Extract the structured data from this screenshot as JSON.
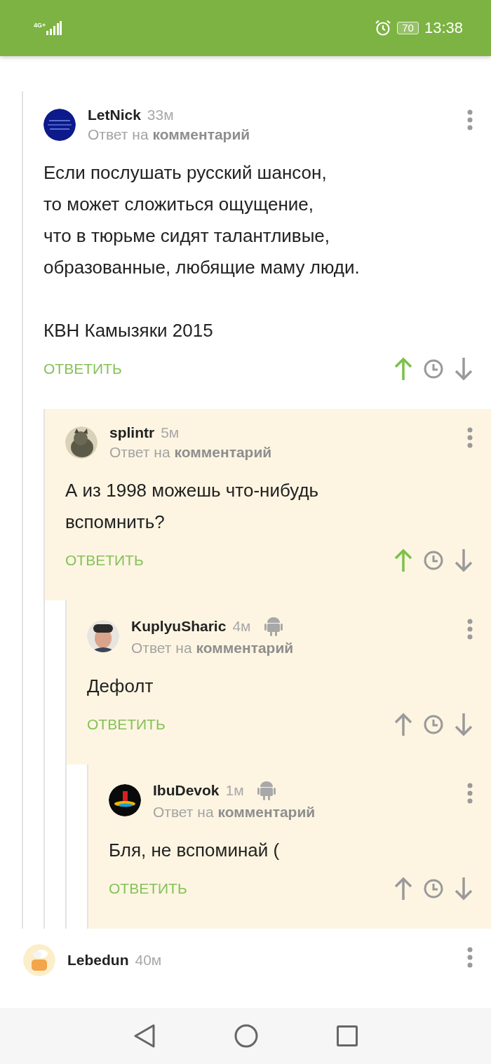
{
  "status_bar": {
    "network": "4G+",
    "battery": "70",
    "time": "13:38"
  },
  "comments": [
    {
      "kind": "reply",
      "author": "LetNick",
      "time": "33м",
      "android": false,
      "reply_to": "Ответ на **комментарий**",
      "highlighted": false,
      "body": [
        "Если послушать русский шансон,\nто может сложиться ощущение,\nчто в тюрьме сидят талантливые,\nобразованные, любящие маму люди.",
        "КВН Камызяки 2015"
      ],
      "reply_label": "ОТВЕТИТЬ",
      "upvoted": true,
      "children": [
        {
          "author": "splintr",
          "time": "5м",
          "android": false,
          "reply_to": "Ответ на **комментарий**",
          "highlighted": true,
          "body": [
            "А из 1998 можешь что-нибудь\nвспомнить?"
          ],
          "reply_label": "ОТВЕТИТЬ",
          "upvoted": true,
          "children": [
            {
              "author": "KuplyuSharic",
              "time": "4м",
              "android": true,
              "reply_to": "Ответ на **комментарий**",
              "highlighted": true,
              "body": [
                "Дефолт"
              ],
              "reply_label": "ОТВЕТИТЬ",
              "upvoted": false,
              "children": [
                {
                  "author": "IbuDevok",
                  "time": "1м",
                  "android": true,
                  "reply_to": "Ответ на **комментарий**",
                  "highlighted": true,
                  "body": [
                    "Бля, не вспоминай ("
                  ],
                  "reply_label": "ОТВЕТИТЬ",
                  "upvoted": false
                }
              ]
            }
          ]
        }
      ]
    },
    {
      "kind": "root",
      "author": "Lebedun",
      "time": "40м",
      "android": false
    }
  ]
}
